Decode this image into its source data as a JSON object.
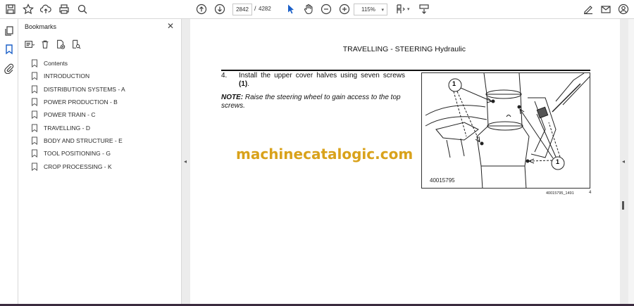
{
  "toolbar": {
    "page_current": "2842",
    "page_separator": "/",
    "page_total": "4282",
    "zoom": "115%"
  },
  "panel": {
    "title": "Bookmarks"
  },
  "bookmarks": [
    {
      "label": "Contents"
    },
    {
      "label": "INTRODUCTION"
    },
    {
      "label": "DISTRIBUTION SYSTEMS - A"
    },
    {
      "label": "POWER PRODUCTION - B"
    },
    {
      "label": "POWER TRAIN - C"
    },
    {
      "label": "TRAVELLING - D"
    },
    {
      "label": "BODY AND STRUCTURE - E"
    },
    {
      "label": "TOOL POSITIONING - G"
    },
    {
      "label": "CROP PROCESSING - K"
    }
  ],
  "document": {
    "header": "TRAVELLING - STEERING Hydraulic",
    "step_number": "4.",
    "step_text_pre": "Install the upper cover halves using seven screws ",
    "step_text_bold": "(1)",
    "step_text_post": ".",
    "note_label": "NOTE:",
    "note_text": " Raise the steering wheel to gain access to the top screws.",
    "watermark": "machinecatalogic.com",
    "figure_code": "40015795",
    "callout_1a": "1",
    "callout_1b": "1",
    "caption_code": "40015795_1491",
    "caption_num": "4"
  },
  "colors": {
    "accent": "#1a5fc8",
    "watermark": "#d9a21b"
  }
}
